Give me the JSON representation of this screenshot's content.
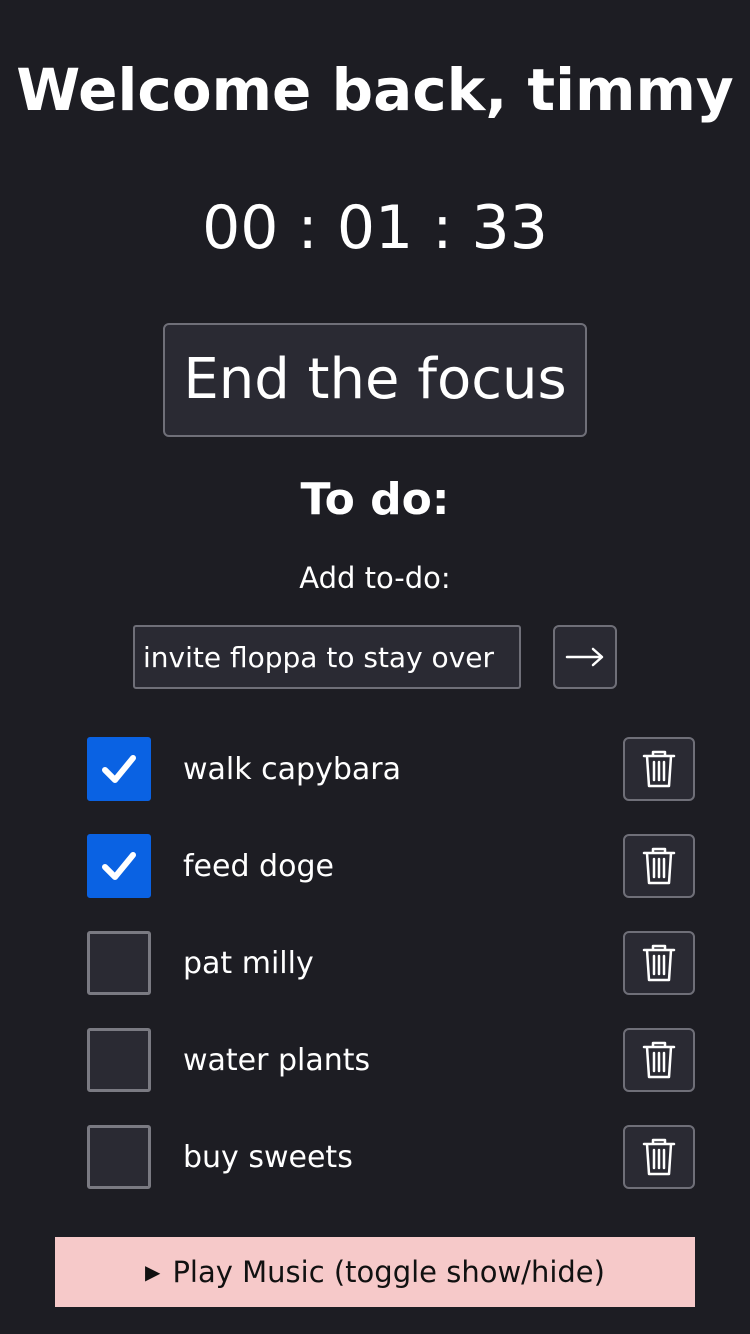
{
  "welcome": "Welcome back, timmy",
  "timer": "00 : 01 : 33",
  "end_button": "End the focus",
  "todo_title": "To do:",
  "add_label": "Add to-do:",
  "add_input_value": "invite floppa to stay over",
  "add_button_icon": "arrow-right-icon",
  "accent_color": "#0a62e3",
  "todos": [
    {
      "label": "walk capybara",
      "checked": true
    },
    {
      "label": "feed doge",
      "checked": true
    },
    {
      "label": "pat milly",
      "checked": false
    },
    {
      "label": "water plants",
      "checked": false
    },
    {
      "label": "buy sweets",
      "checked": false
    }
  ],
  "delete_icon": "trash-icon",
  "music": {
    "triangle": "▶",
    "label": "Play Music (toggle show/hide)",
    "color": "#f6c9c9"
  }
}
